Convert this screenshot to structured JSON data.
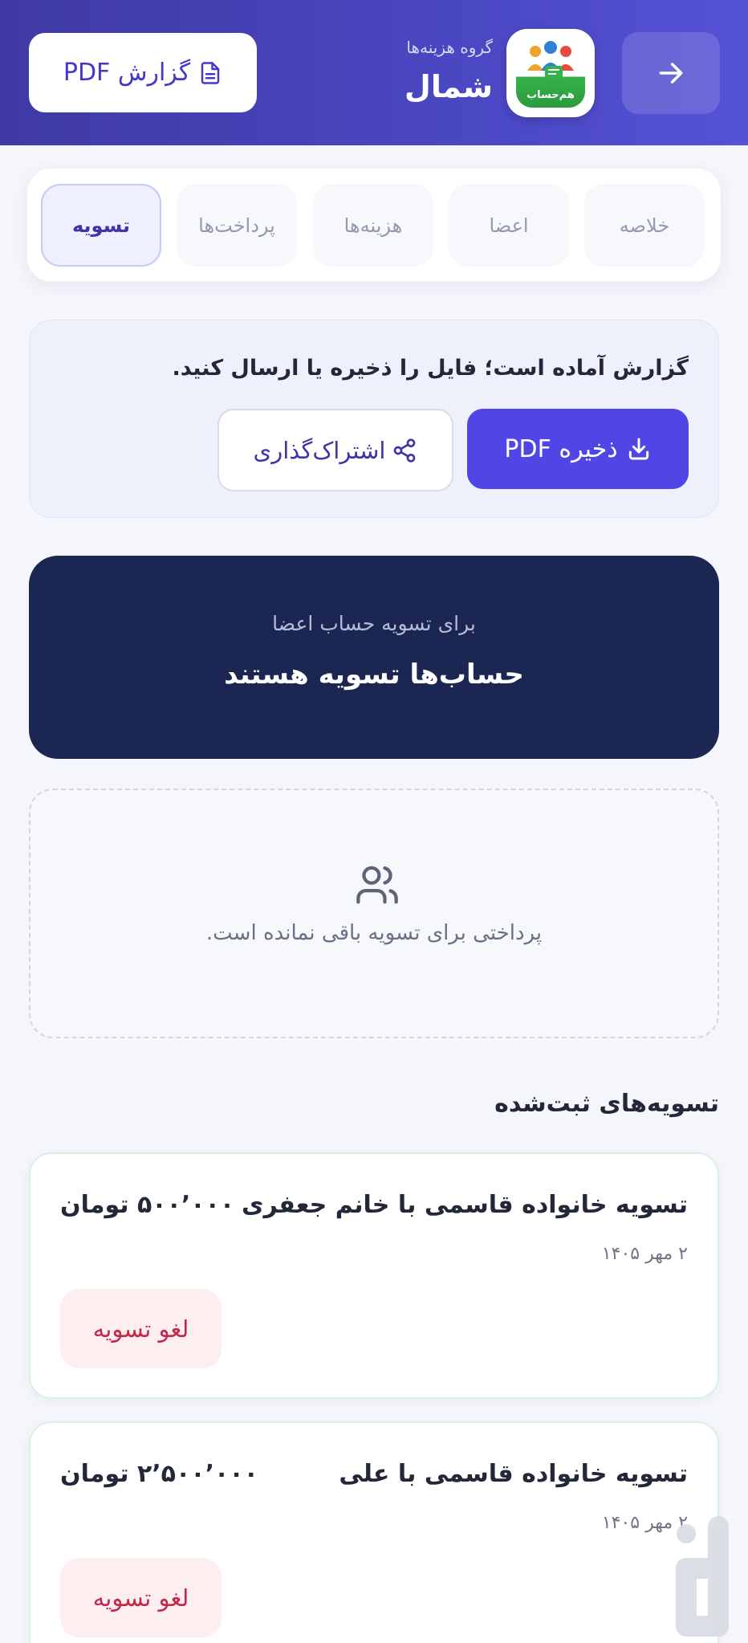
{
  "header": {
    "group_subtitle": "گروه هزینه‌ها",
    "group_title": "شمال",
    "app_logo_text": "هم‌حساب",
    "pdf_report_label": "گزارش PDF"
  },
  "tabs": [
    {
      "label": "خلاصه",
      "active": false
    },
    {
      "label": "اعضا",
      "active": false
    },
    {
      "label": "هزینه‌ها",
      "active": false
    },
    {
      "label": "پرداخت‌ها",
      "active": false
    },
    {
      "label": "تسویه",
      "active": true
    }
  ],
  "report": {
    "message": "گزارش آماده است؛ فایل را ذخیره یا ارسال کنید.",
    "save_label": "ذخیره PDF",
    "share_label": "اشتراک‌گذاری"
  },
  "status_card": {
    "subtitle": "برای تسویه حساب اعضا",
    "title": "حساب‌ها تسویه هستند"
  },
  "empty_state": {
    "message": "پرداختی برای تسویه باقی نمانده است."
  },
  "settlements_section": {
    "title": "تسویه‌های ثبت‌شده",
    "items": [
      {
        "title": "تسویه خانواده قاسمی با خانم جعفری",
        "amount": "۵۰۰٬۰۰۰ تومان",
        "date": "۲ مهر ۱۴۰۵",
        "cancel_label": "لغو تسویه"
      },
      {
        "title": "تسویه خانواده قاسمی با علی",
        "amount": "۲٬۵۰۰٬۰۰۰ تومان",
        "date": "۲ مهر ۱۴۰۵",
        "cancel_label": "لغو تسویه"
      }
    ]
  },
  "colors": {
    "header_gradient_start": "#3f3aa3",
    "header_gradient_end": "#5552d6",
    "primary": "#4f46e5",
    "status_card_bg": "#1b2752",
    "cancel_text": "#c2284a",
    "cancel_bg": "#fdeef0"
  },
  "icons": {
    "back": "arrow-right-icon",
    "pdf_report": "document-icon",
    "save": "download-icon",
    "share": "share-icon",
    "empty": "users-icon"
  }
}
